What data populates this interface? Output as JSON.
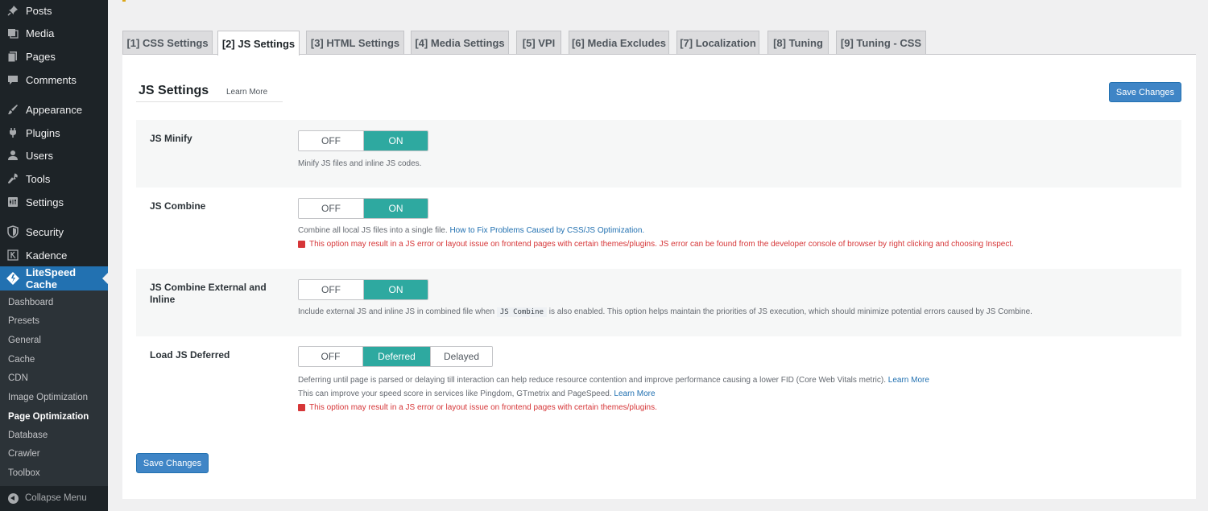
{
  "sidebar": {
    "items": [
      {
        "label": "Posts",
        "icon": "pin-icon"
      },
      {
        "label": "Media",
        "icon": "media-icon"
      },
      {
        "label": "Pages",
        "icon": "pages-icon"
      },
      {
        "label": "Comments",
        "icon": "comments-icon"
      },
      {
        "label": "Appearance",
        "icon": "brush-icon"
      },
      {
        "label": "Plugins",
        "icon": "plug-icon"
      },
      {
        "label": "Users",
        "icon": "user-icon"
      },
      {
        "label": "Tools",
        "icon": "wrench-icon"
      },
      {
        "label": "Settings",
        "icon": "settings-icon"
      },
      {
        "label": "Security",
        "icon": "shield-icon"
      },
      {
        "label": "Kadence",
        "icon": "kadence-icon"
      },
      {
        "label": "LiteSpeed Cache",
        "icon": "litespeed-icon"
      }
    ],
    "submenu": [
      "Dashboard",
      "Presets",
      "General",
      "Cache",
      "CDN",
      "Image Optimization",
      "Page Optimization",
      "Database",
      "Crawler",
      "Toolbox"
    ],
    "current_submenu": "Page Optimization",
    "collapse_label": "Collapse Menu"
  },
  "tabs": [
    "[1] CSS Settings",
    "[2] JS Settings",
    "[3] HTML Settings",
    "[4] Media Settings",
    "[5] VPI",
    "[6] Media Excludes",
    "[7] Localization",
    "[8] Tuning",
    "[9] Tuning - CSS"
  ],
  "active_tab": "[2] JS Settings",
  "section": {
    "title": "JS Settings",
    "learn_more": "Learn More",
    "save_label": "Save Changes"
  },
  "settings": {
    "js_minify": {
      "label": "JS Minify",
      "off": "OFF",
      "on": "ON",
      "value": "ON",
      "desc": "Minify JS files and inline JS codes."
    },
    "js_combine": {
      "label": "JS Combine",
      "off": "OFF",
      "on": "ON",
      "value": "ON",
      "desc": "Combine all local JS files into a single file.",
      "link": "How to Fix Problems Caused by CSS/JS Optimization.",
      "warning": "This option may result in a JS error or layout issue on frontend pages with certain themes/plugins. JS error can be found from the developer console of browser by right clicking and choosing Inspect."
    },
    "js_combine_external": {
      "label": "JS Combine External and Inline",
      "off": "OFF",
      "on": "ON",
      "value": "ON",
      "desc_pre": "Include external JS and inline JS in combined file when",
      "code": "JS Combine",
      "desc_post": "is also enabled. This option helps maintain the priorities of JS execution, which should minimize potential errors caused by JS Combine."
    },
    "load_js_deferred": {
      "label": "Load JS Deferred",
      "off": "OFF",
      "deferred": "Deferred",
      "delayed": "Delayed",
      "value": "Deferred",
      "desc1": "Deferring until page is parsed or delaying till interaction can help reduce resource contention and improve performance causing a lower FID (Core Web Vitals metric).",
      "desc1_link": "Learn More",
      "desc2": "This can improve your speed score in services like Pingdom, GTmetrix and PageSpeed.",
      "desc2_link": "Learn More",
      "warning": "This option may result in a JS error or layout issue on frontend pages with certain themes/plugins."
    }
  },
  "colors": {
    "sidebar_bg": "#1d2327",
    "accent": "#2271b1",
    "toggle_on": "#2ea9a0",
    "warning": "#d63638"
  }
}
